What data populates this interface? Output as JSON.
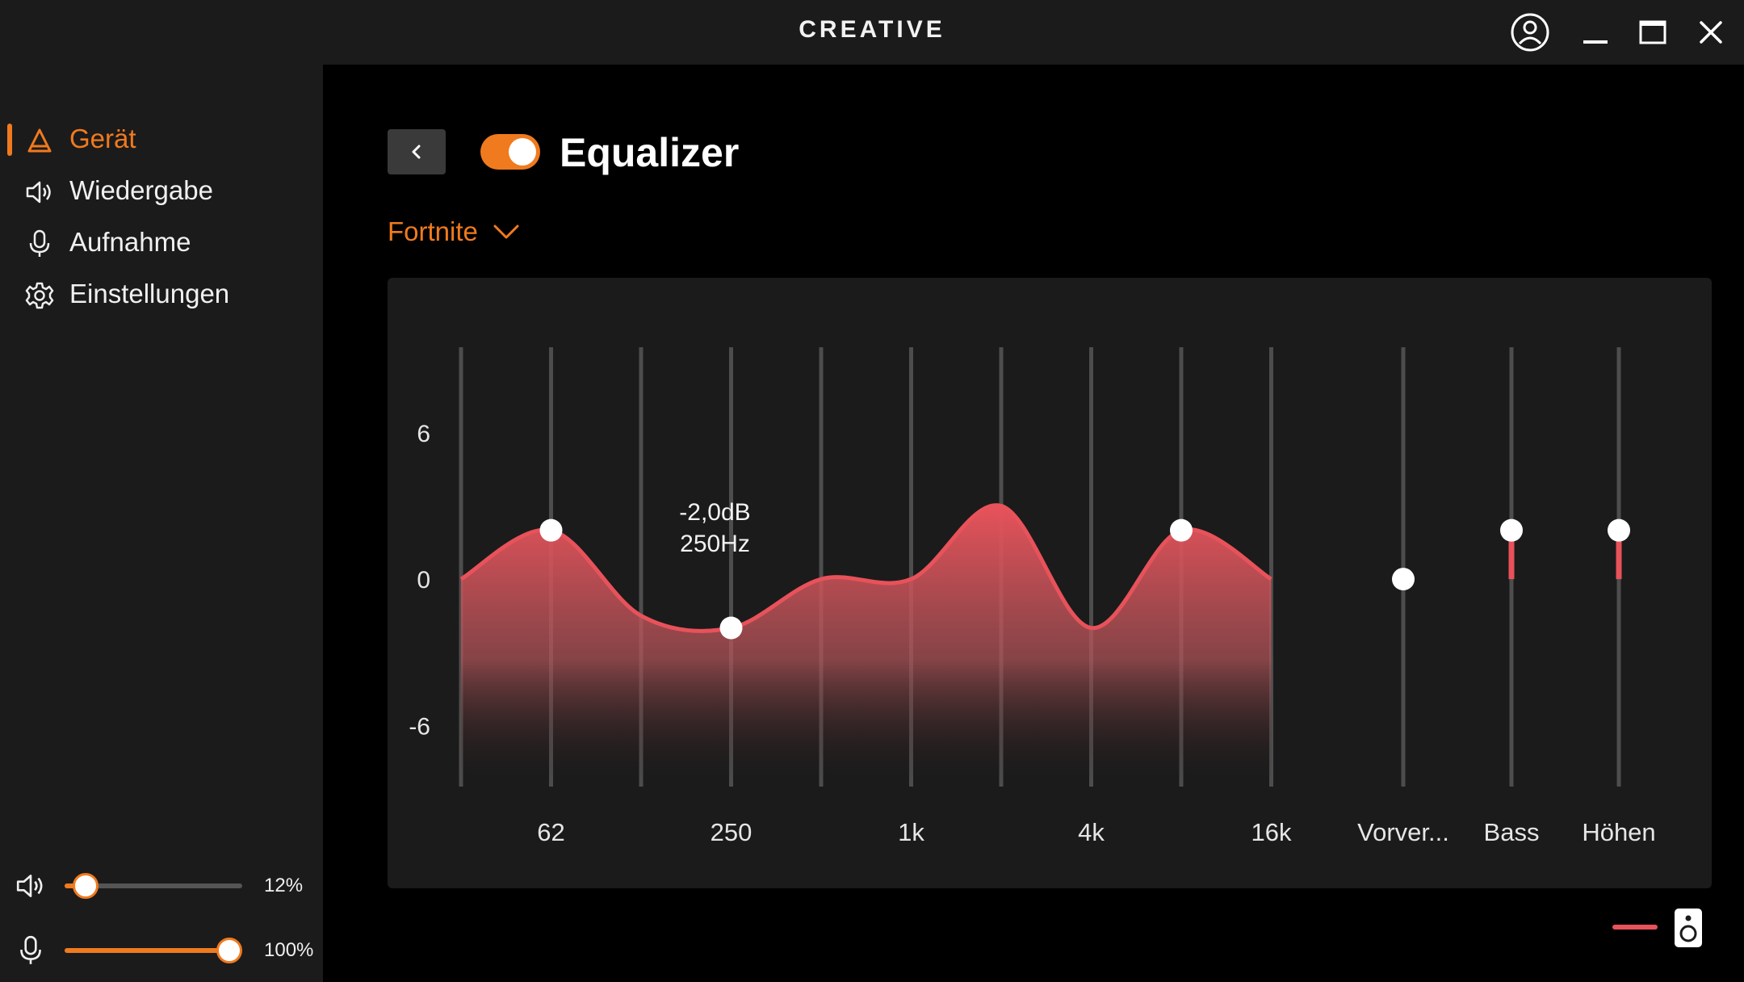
{
  "app": {
    "brand": "CREATIVE"
  },
  "window_controls": [
    "user-account",
    "minimize",
    "maximize",
    "close"
  ],
  "sidebar": {
    "items": [
      {
        "label": "Gerät",
        "icon": "device-triangle-icon",
        "active": true
      },
      {
        "label": "Wiedergabe",
        "icon": "speaker-icon",
        "active": false
      },
      {
        "label": "Aufnahme",
        "icon": "microphone-icon",
        "active": false
      },
      {
        "label": "Einstellungen",
        "icon": "gear-icon",
        "active": false
      }
    ],
    "volume": {
      "icon": "speaker-icon",
      "value_label": "12%",
      "fraction": 0.12
    },
    "mic": {
      "icon": "microphone-icon",
      "value_label": "100%",
      "fraction": 1.0
    }
  },
  "equalizer": {
    "title": "Equalizer",
    "enabled": true,
    "preset": "Fortnite",
    "accent_color": "#f07a1e",
    "curve_color": "#e8525a",
    "y_ticks": [
      "6",
      "0",
      "-6"
    ],
    "y_range": [
      -8.5,
      9.5
    ],
    "band_freqs": [
      31,
      62,
      125,
      250,
      500,
      1000,
      2000,
      4000,
      8000,
      16000
    ],
    "band_gains": [
      0,
      2,
      -1.5,
      -2,
      0,
      0,
      3,
      -2,
      2,
      0
    ],
    "handle_bands": [
      1,
      3,
      8
    ],
    "x_labels": [
      {
        "band": 1,
        "text": "62"
      },
      {
        "band": 3,
        "text": "250"
      },
      {
        "band": 5,
        "text": "1k"
      },
      {
        "band": 7,
        "text": "4k"
      },
      {
        "band": 9,
        "text": "16k"
      }
    ],
    "tooltip": {
      "gain": "-2,0dB",
      "freq": "250Hz"
    },
    "extra_sliders": [
      {
        "label": "Vorver...",
        "value": 0
      },
      {
        "label": "Bass",
        "value": 2
      },
      {
        "label": "Höhen",
        "value": 2
      }
    ]
  }
}
